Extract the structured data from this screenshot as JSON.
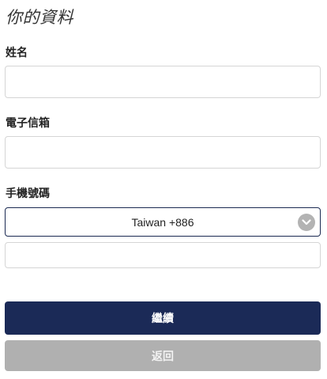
{
  "page": {
    "title": "你的資料"
  },
  "form": {
    "name": {
      "label": "姓名",
      "value": "",
      "placeholder": ""
    },
    "email": {
      "label": "電子信箱",
      "value": "",
      "placeholder": ""
    },
    "phone": {
      "label": "手機號碼",
      "country_selected": "Taiwan +886",
      "value": "",
      "placeholder": ""
    }
  },
  "actions": {
    "continue_label": "繼續",
    "back_label": "返回"
  },
  "icons": {
    "select_arrow": "chevron-down-icon"
  },
  "colors": {
    "primary": "#1b2a57",
    "secondary": "#b0b0b0",
    "select_border": "#1b2a52",
    "arrow_circle": "#b3b3b3"
  }
}
